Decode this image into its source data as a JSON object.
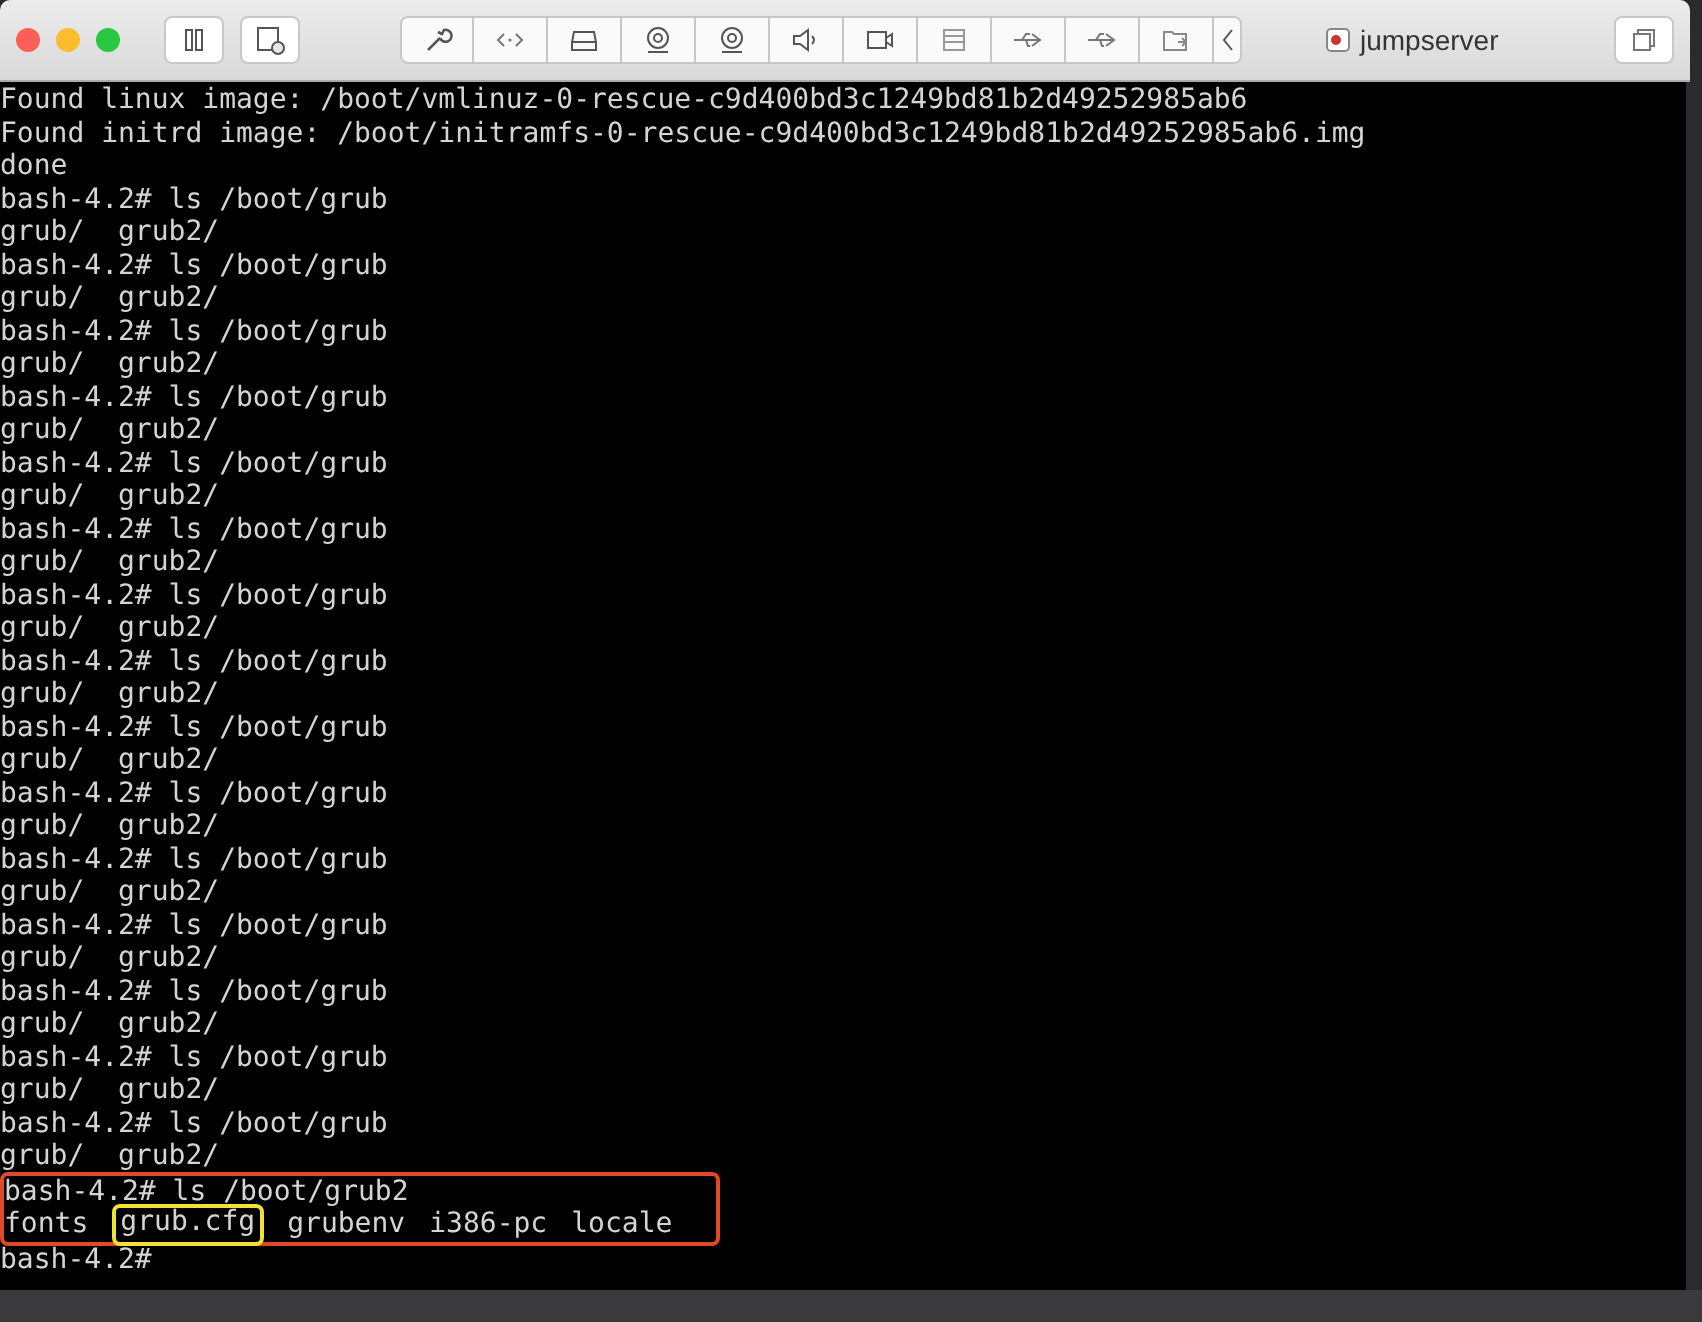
{
  "window": {
    "title": "jumpserver"
  },
  "terminal": {
    "lines": [
      {
        "kind": "text",
        "text": "Found linux image: /boot/vmlinuz-0-rescue-c9d400bd3c1249bd81b2d49252985ab6",
        "boxed": false
      },
      {
        "kind": "text",
        "text": "Found initrd image: /boot/initramfs-0-rescue-c9d400bd3c1249bd81b2d49252985ab6.img",
        "boxed": false
      },
      {
        "kind": "text",
        "text": "done",
        "boxed": false
      },
      {
        "kind": "text",
        "text": "bash-4.2# ls /boot/grub",
        "boxed": false
      },
      {
        "kind": "text",
        "text": "grub/  grub2/",
        "boxed": false
      },
      {
        "kind": "text",
        "text": "bash-4.2# ls /boot/grub",
        "boxed": false
      },
      {
        "kind": "text",
        "text": "grub/  grub2/",
        "boxed": false
      },
      {
        "kind": "text",
        "text": "bash-4.2# ls /boot/grub",
        "boxed": false
      },
      {
        "kind": "text",
        "text": "grub/  grub2/",
        "boxed": false
      },
      {
        "kind": "text",
        "text": "bash-4.2# ls /boot/grub",
        "boxed": false
      },
      {
        "kind": "text",
        "text": "grub/  grub2/",
        "boxed": false
      },
      {
        "kind": "text",
        "text": "bash-4.2# ls /boot/grub",
        "boxed": false
      },
      {
        "kind": "text",
        "text": "grub/  grub2/",
        "boxed": false
      },
      {
        "kind": "text",
        "text": "bash-4.2# ls /boot/grub",
        "boxed": false
      },
      {
        "kind": "text",
        "text": "grub/  grub2/",
        "boxed": false
      },
      {
        "kind": "text",
        "text": "bash-4.2# ls /boot/grub",
        "boxed": false
      },
      {
        "kind": "text",
        "text": "grub/  grub2/",
        "boxed": false
      },
      {
        "kind": "text",
        "text": "bash-4.2# ls /boot/grub",
        "boxed": false
      },
      {
        "kind": "text",
        "text": "grub/  grub2/",
        "boxed": false
      },
      {
        "kind": "text",
        "text": "bash-4.2# ls /boot/grub",
        "boxed": false
      },
      {
        "kind": "text",
        "text": "grub/  grub2/",
        "boxed": false
      },
      {
        "kind": "text",
        "text": "bash-4.2# ls /boot/grub",
        "boxed": false
      },
      {
        "kind": "text",
        "text": "grub/  grub2/",
        "boxed": false
      },
      {
        "kind": "text",
        "text": "bash-4.2# ls /boot/grub",
        "boxed": false
      },
      {
        "kind": "text",
        "text": "grub/  grub2/",
        "boxed": false
      },
      {
        "kind": "text",
        "text": "bash-4.2# ls /boot/grub",
        "boxed": false
      },
      {
        "kind": "text",
        "text": "grub/  grub2/",
        "boxed": false
      },
      {
        "kind": "text",
        "text": "bash-4.2# ls /boot/grub",
        "boxed": false
      },
      {
        "kind": "text",
        "text": "grub/  grub2/",
        "boxed": false
      },
      {
        "kind": "text",
        "text": "bash-4.2# ls /boot/grub",
        "boxed": false
      },
      {
        "kind": "text",
        "text": "grub/  grub2/",
        "boxed": false
      },
      {
        "kind": "text",
        "text": "bash-4.2# ls /boot/grub",
        "boxed": false
      },
      {
        "kind": "text",
        "text": "grub/  grub2/",
        "boxed": false
      },
      {
        "kind": "text",
        "text": "bash-4.2# ls /boot/grub2",
        "boxed": true
      },
      {
        "kind": "segments",
        "boxed": true,
        "segments": [
          {
            "text": "fonts",
            "circled": false
          },
          {
            "text": "grub.cfg",
            "circled": true
          },
          {
            "text": "grubenv",
            "circled": false
          },
          {
            "text": "i386-pc",
            "circled": false
          },
          {
            "text": "locale",
            "circled": false
          }
        ]
      },
      {
        "kind": "text",
        "text": "bash-4.2#",
        "boxed": false
      }
    ]
  }
}
